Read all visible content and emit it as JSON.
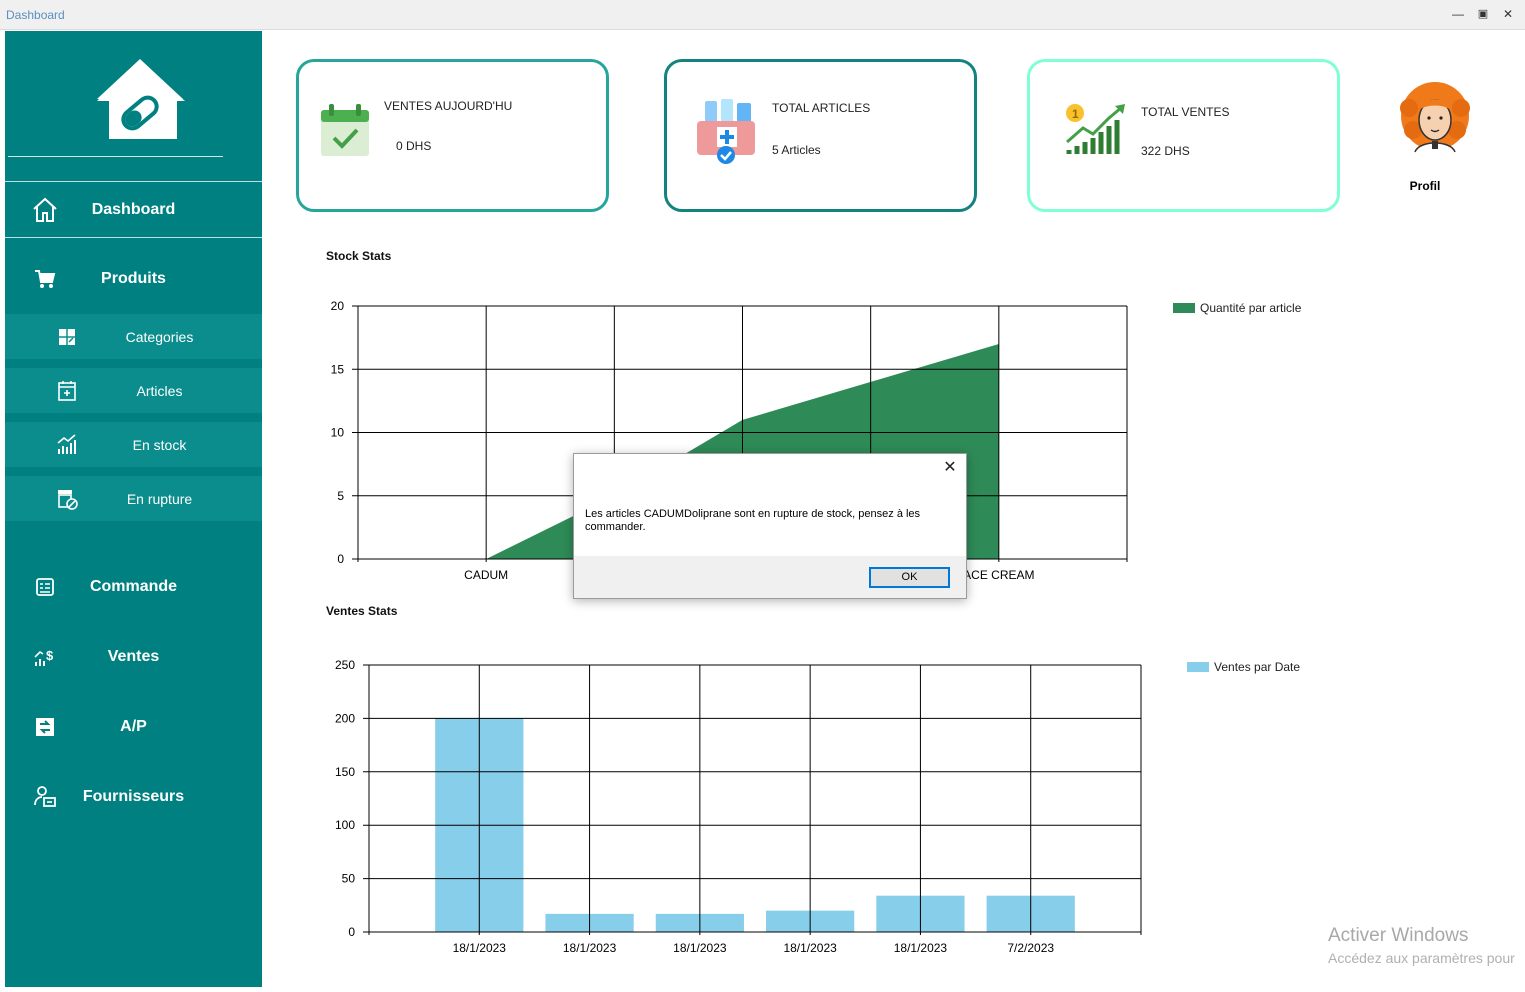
{
  "window": {
    "title": "Dashboard"
  },
  "sidebar": {
    "items": [
      {
        "label": "Dashboard",
        "icon": "home-icon"
      },
      {
        "label": "Produits",
        "icon": "cart-icon"
      },
      {
        "label": "Categories",
        "icon": "categories-icon"
      },
      {
        "label": "Articles",
        "icon": "articles-icon"
      },
      {
        "label": "En stock",
        "icon": "stock-chart-icon"
      },
      {
        "label": "En rupture",
        "icon": "out-of-stock-icon"
      },
      {
        "label": "Commande",
        "icon": "order-icon"
      },
      {
        "label": "Ventes",
        "icon": "sales-icon"
      },
      {
        "label": "A/P",
        "icon": "ap-icon"
      },
      {
        "label": "Fournisseurs",
        "icon": "suppliers-icon"
      }
    ]
  },
  "cards": [
    {
      "title": "VENTES AUJOURD'HU",
      "value": "0 DHS",
      "icon": "calendar-check-icon",
      "border": "#26a69a"
    },
    {
      "title": "TOTAL ARTICLES",
      "value": "5 Articles",
      "icon": "medical-kit-icon",
      "border": "#14827f"
    },
    {
      "title": "TOTAL VENTES",
      "value": "322 DHS",
      "icon": "growth-chart-icon",
      "border": "#7fffd4"
    }
  ],
  "profile": {
    "label": "Profil",
    "icon": "avatar"
  },
  "stock_chart": {
    "title": "Stock Stats",
    "legend": "Quantité par article",
    "color": "#2e8b57"
  },
  "sales_chart": {
    "title": "Ventes Stats",
    "legend": "Ventes par Date",
    "color": "#87ceeb"
  },
  "chart_data": [
    {
      "type": "area",
      "title": "Stock Stats",
      "categories": [
        "CADUM",
        "",
        "",
        "",
        "ACE CREAM",
        ""
      ],
      "series": [
        {
          "name": "Quantité par article",
          "values": [
            0,
            5,
            11,
            14,
            17
          ]
        }
      ],
      "ylim": [
        0,
        20
      ],
      "yticks": [
        0,
        5,
        10,
        15,
        20
      ],
      "legend": "right"
    },
    {
      "type": "bar",
      "title": "Ventes Stats",
      "categories": [
        "18/1/2023",
        "18/1/2023",
        "18/1/2023",
        "18/1/2023",
        "18/1/2023",
        "7/2/2023"
      ],
      "series": [
        {
          "name": "Ventes par Date",
          "values": [
            200,
            17,
            17,
            20,
            34,
            34
          ]
        }
      ],
      "ylim": [
        0,
        250
      ],
      "yticks": [
        0,
        50,
        100,
        150,
        200,
        250
      ],
      "legend": "right"
    }
  ],
  "dialog": {
    "message": "Les articles CADUMDoliprane sont en rupture de stock, pensez à les commander.",
    "ok_label": "OK",
    "close_label": "✕"
  },
  "watermark": {
    "line1": "Activer Windows",
    "line2": "Accédez aux paramètres pour"
  }
}
